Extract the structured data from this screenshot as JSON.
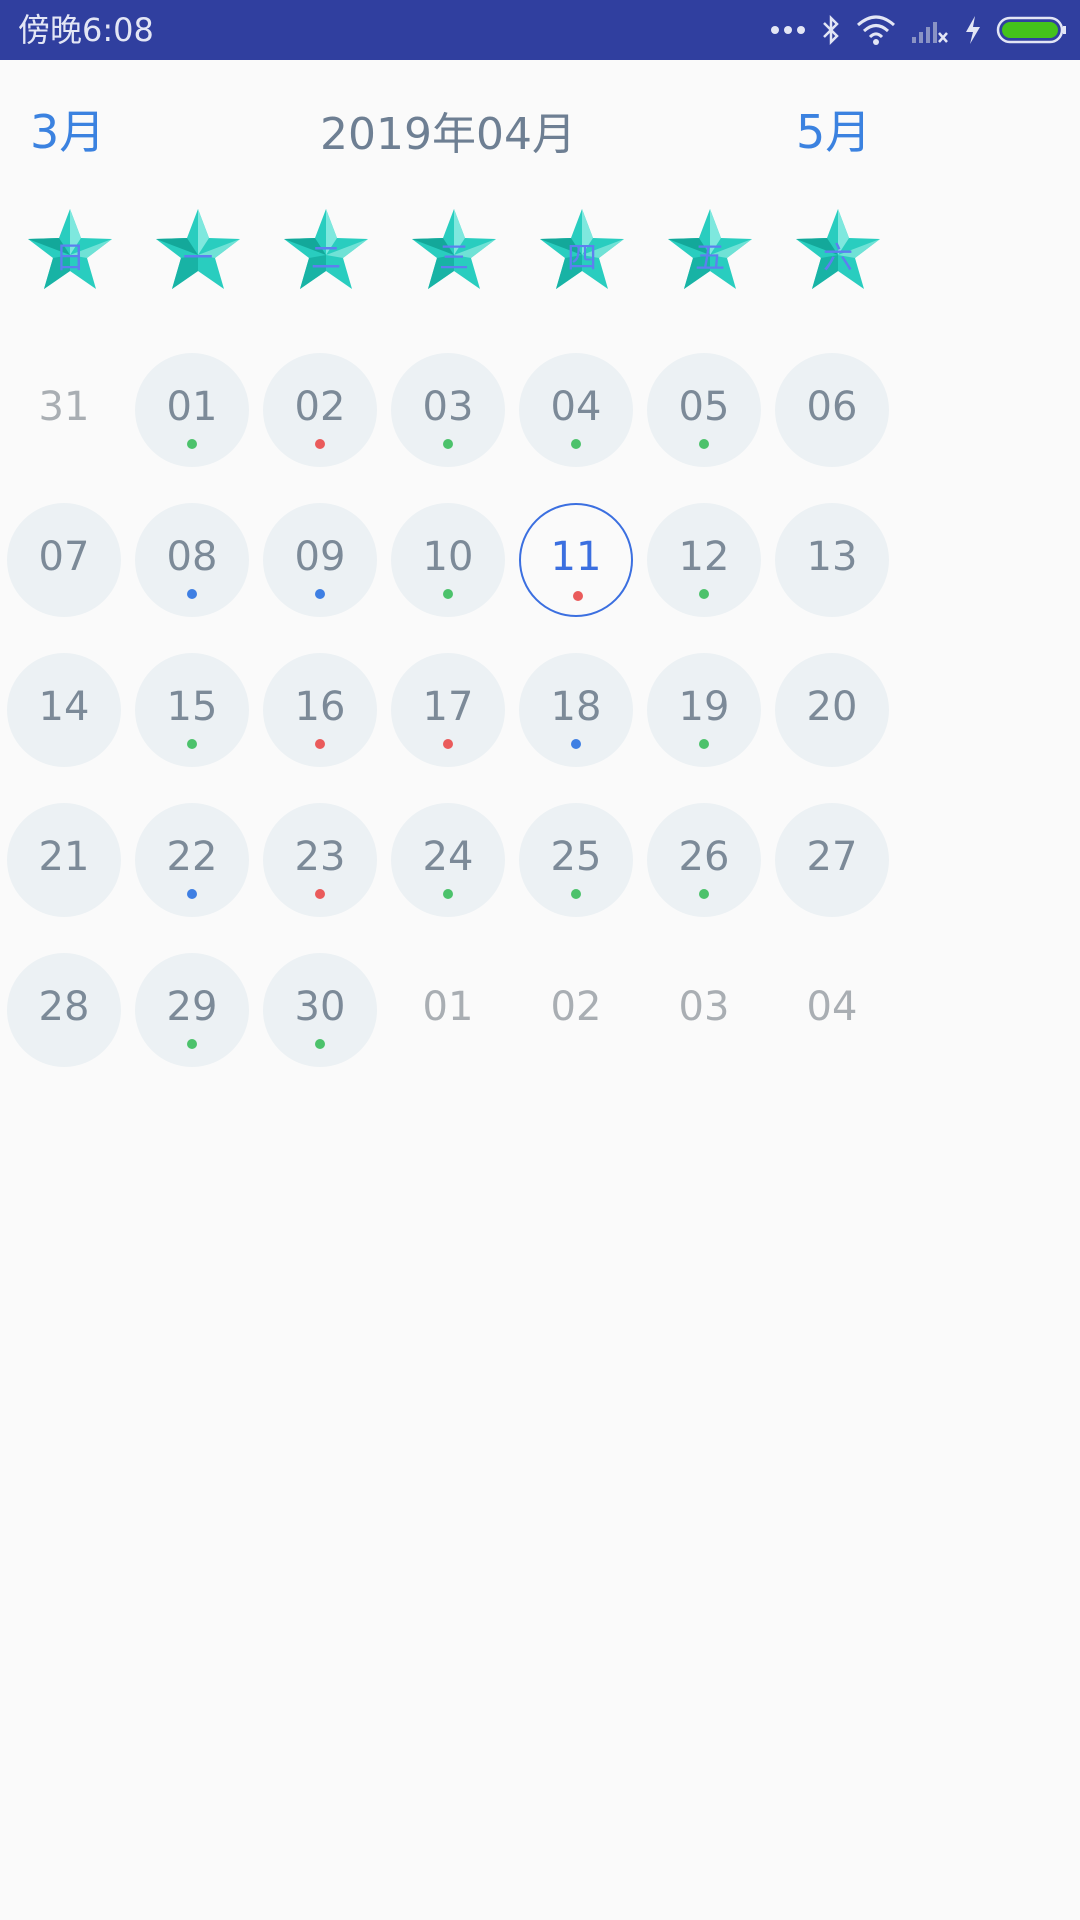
{
  "status_bar": {
    "time": "傍晚6:08",
    "icons": [
      "more-dots-icon",
      "bluetooth-icon",
      "wifi-icon",
      "signal-no-sim-icon",
      "charging-icon",
      "battery-icon"
    ],
    "battery_color": "#44c21a"
  },
  "header": {
    "prev_month": "3月",
    "title": "2019年04月",
    "next_month": "5月"
  },
  "weekdays": [
    "日",
    "一",
    "二",
    "三",
    "四",
    "五",
    "六"
  ],
  "dot_colors": {
    "green": "#4cc26b",
    "red": "#ea5b5b",
    "blue": "#3e7fe3"
  },
  "weeks": [
    [
      {
        "day": "31",
        "outside": true,
        "dot": null
      },
      {
        "day": "01",
        "outside": false,
        "dot": "green"
      },
      {
        "day": "02",
        "outside": false,
        "dot": "red"
      },
      {
        "day": "03",
        "outside": false,
        "dot": "green"
      },
      {
        "day": "04",
        "outside": false,
        "dot": "green"
      },
      {
        "day": "05",
        "outside": false,
        "dot": "green"
      },
      {
        "day": "06",
        "outside": false,
        "dot": null
      }
    ],
    [
      {
        "day": "07",
        "outside": false,
        "dot": null
      },
      {
        "day": "08",
        "outside": false,
        "dot": "blue"
      },
      {
        "day": "09",
        "outside": false,
        "dot": "blue"
      },
      {
        "day": "10",
        "outside": false,
        "dot": "green"
      },
      {
        "day": "11",
        "outside": false,
        "dot": "red",
        "selected": true
      },
      {
        "day": "12",
        "outside": false,
        "dot": "green"
      },
      {
        "day": "13",
        "outside": false,
        "dot": null
      }
    ],
    [
      {
        "day": "14",
        "outside": false,
        "dot": null
      },
      {
        "day": "15",
        "outside": false,
        "dot": "green"
      },
      {
        "day": "16",
        "outside": false,
        "dot": "red"
      },
      {
        "day": "17",
        "outside": false,
        "dot": "red"
      },
      {
        "day": "18",
        "outside": false,
        "dot": "blue"
      },
      {
        "day": "19",
        "outside": false,
        "dot": "green"
      },
      {
        "day": "20",
        "outside": false,
        "dot": null
      }
    ],
    [
      {
        "day": "21",
        "outside": false,
        "dot": null
      },
      {
        "day": "22",
        "outside": false,
        "dot": "blue"
      },
      {
        "day": "23",
        "outside": false,
        "dot": "red"
      },
      {
        "day": "24",
        "outside": false,
        "dot": "green"
      },
      {
        "day": "25",
        "outside": false,
        "dot": "green"
      },
      {
        "day": "26",
        "outside": false,
        "dot": "green"
      },
      {
        "day": "27",
        "outside": false,
        "dot": null
      }
    ],
    [
      {
        "day": "28",
        "outside": false,
        "dot": null
      },
      {
        "day": "29",
        "outside": false,
        "dot": "green"
      },
      {
        "day": "30",
        "outside": false,
        "dot": "green"
      },
      {
        "day": "01",
        "outside": true,
        "dot": null
      },
      {
        "day": "02",
        "outside": true,
        "dot": null
      },
      {
        "day": "03",
        "outside": true,
        "dot": null
      },
      {
        "day": "04",
        "outside": true,
        "dot": null
      }
    ]
  ]
}
